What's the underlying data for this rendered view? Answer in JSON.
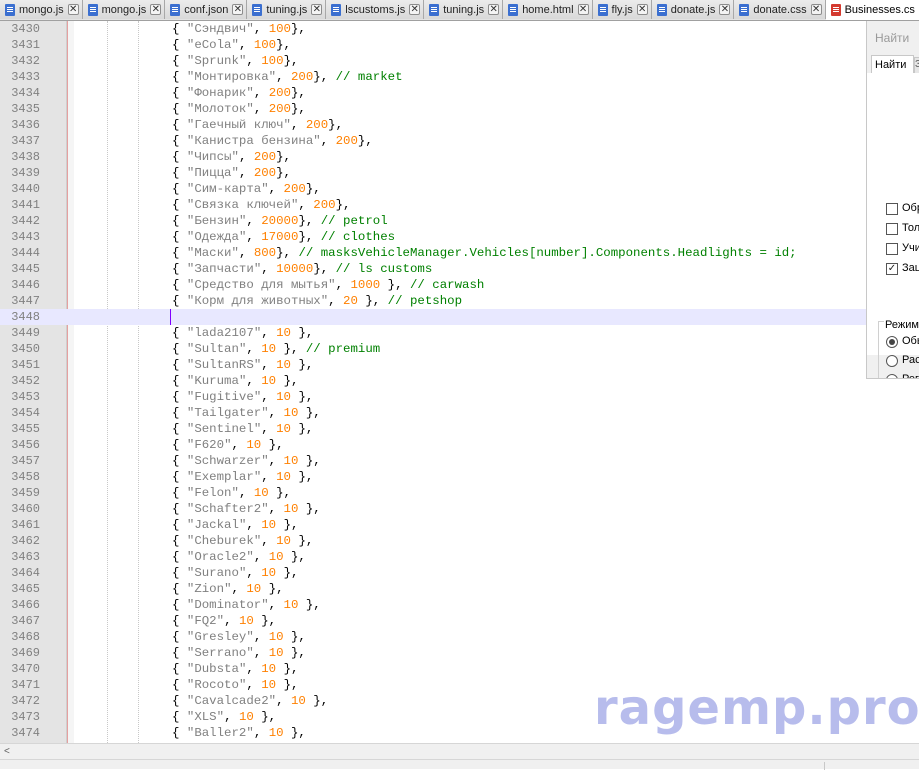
{
  "tabs": [
    {
      "label": "mongo.js",
      "active": false
    },
    {
      "label": "mongo.js",
      "active": false
    },
    {
      "label": "conf.json",
      "active": false
    },
    {
      "label": "tuning.js",
      "active": false
    },
    {
      "label": "lscustoms.js",
      "active": false
    },
    {
      "label": "tuning.js",
      "active": false
    },
    {
      "label": "home.html",
      "active": false
    },
    {
      "label": "fly.js",
      "active": false
    },
    {
      "label": "donate.js",
      "active": false
    },
    {
      "label": "donate.css",
      "active": false
    },
    {
      "label": "Businesses.cs",
      "active": true
    }
  ],
  "tab_close_glyph": "✕",
  "editor": {
    "current_line": 3448,
    "lines": [
      {
        "n": "3430",
        "name": "Сэндвич",
        "val": "100",
        "close": "},"
      },
      {
        "n": "3431",
        "name": "eCola",
        "val": "100",
        "close": "},"
      },
      {
        "n": "3432",
        "name": "Sprunk",
        "val": "100",
        "close": "},"
      },
      {
        "n": "3433",
        "name": "Монтировка",
        "val": "200",
        "close": "},",
        "comment": "// market"
      },
      {
        "n": "3434",
        "name": "Фонарик",
        "val": "200",
        "close": "},"
      },
      {
        "n": "3435",
        "name": "Молоток",
        "val": "200",
        "close": "},"
      },
      {
        "n": "3436",
        "name": "Гаечный ключ",
        "val": "200",
        "close": "},"
      },
      {
        "n": "3437",
        "name": "Канистра бензина",
        "val": "200",
        "close": "},"
      },
      {
        "n": "3438",
        "name": "Чипсы",
        "val": "200",
        "close": "},"
      },
      {
        "n": "3439",
        "name": "Пицца",
        "val": "200",
        "close": "},"
      },
      {
        "n": "3440",
        "name": "Сим-карта",
        "val": "200",
        "close": "},"
      },
      {
        "n": "3441",
        "name": "Связка ключей",
        "val": "200",
        "close": "},"
      },
      {
        "n": "3442",
        "name": "Бензин",
        "val": "20000",
        "close": "},",
        "comment": "// petrol"
      },
      {
        "n": "3443",
        "name": "Одежда",
        "val": "17000",
        "close": "},",
        "comment": "// clothes"
      },
      {
        "n": "3444",
        "name": "Маски",
        "val": "800",
        "close": "},",
        "comment": "// masksVehicleManager.Vehicles[number].Components.Headlights = id;"
      },
      {
        "n": "3445",
        "name": "Запчасти",
        "val": "10000",
        "close": "},",
        "comment": "// ls customs"
      },
      {
        "n": "3446",
        "name": "Средство для мытья",
        "val": "1000 ",
        "close": "},",
        "comment": "// carwash"
      },
      {
        "n": "3447",
        "name": "Корм для животных",
        "val": "20 ",
        "close": "},",
        "comment": "// petshop"
      },
      {
        "n": "3448",
        "empty": true
      },
      {
        "n": "3449",
        "name": "lada2107",
        "val": "10 ",
        "close": "},"
      },
      {
        "n": "3450",
        "name": "Sultan",
        "val": "10 ",
        "close": "},",
        "comment": "// premium"
      },
      {
        "n": "3451",
        "name": "SultanRS",
        "val": "10 ",
        "close": "},"
      },
      {
        "n": "3452",
        "name": "Kuruma",
        "val": "10 ",
        "close": "},"
      },
      {
        "n": "3453",
        "name": "Fugitive",
        "val": "10 ",
        "close": "},"
      },
      {
        "n": "3454",
        "name": "Tailgater",
        "val": "10 ",
        "close": "},"
      },
      {
        "n": "3455",
        "name": "Sentinel",
        "val": "10 ",
        "close": "},"
      },
      {
        "n": "3456",
        "name": "F620",
        "val": "10 ",
        "close": "},"
      },
      {
        "n": "3457",
        "name": "Schwarzer",
        "val": "10 ",
        "close": "},"
      },
      {
        "n": "3458",
        "name": "Exemplar",
        "val": "10 ",
        "close": "},"
      },
      {
        "n": "3459",
        "name": "Felon",
        "val": "10 ",
        "close": "},"
      },
      {
        "n": "3460",
        "name": "Schafter2",
        "val": "10 ",
        "close": "},"
      },
      {
        "n": "3461",
        "name": "Jackal",
        "val": "10 ",
        "close": "},"
      },
      {
        "n": "3462",
        "name": "Cheburek",
        "val": "10 ",
        "close": "},"
      },
      {
        "n": "3463",
        "name": "Oracle2",
        "val": "10 ",
        "close": "},"
      },
      {
        "n": "3464",
        "name": "Surano",
        "val": "10 ",
        "close": "},"
      },
      {
        "n": "3465",
        "name": "Zion",
        "val": "10 ",
        "close": "},"
      },
      {
        "n": "3466",
        "name": "Dominator",
        "val": "10 ",
        "close": "},"
      },
      {
        "n": "3467",
        "name": "FQ2",
        "val": "10 ",
        "close": "},"
      },
      {
        "n": "3468",
        "name": "Gresley",
        "val": "10 ",
        "close": "},"
      },
      {
        "n": "3469",
        "name": "Serrano",
        "val": "10 ",
        "close": "},"
      },
      {
        "n": "3470",
        "name": "Dubsta",
        "val": "10 ",
        "close": "},"
      },
      {
        "n": "3471",
        "name": "Rocoto",
        "val": "10 ",
        "close": "},"
      },
      {
        "n": "3472",
        "name": "Cavalcade2",
        "val": "10 ",
        "close": "},"
      },
      {
        "n": "3473",
        "name": "XLS",
        "val": "10 ",
        "close": "},"
      },
      {
        "n": "3474",
        "name": "Baller2",
        "val": "10 ",
        "close": "},"
      }
    ]
  },
  "find_panel": {
    "title": "Найти",
    "tab_label": "Найти",
    "tab2_label": "З",
    "checkboxes": [
      {
        "label": "Обр",
        "checked": false
      },
      {
        "label": "Тол",
        "checked": false
      },
      {
        "label": "Учи",
        "checked": false
      },
      {
        "label": "Зац",
        "checked": true
      }
    ],
    "mode_group_label": "Режим",
    "modes": [
      {
        "label": "Обы",
        "selected": true
      },
      {
        "label": "Рас",
        "selected": false
      },
      {
        "label": "Рег",
        "selected": false
      }
    ]
  },
  "scrollbar": {
    "left_arrow": "<"
  },
  "watermark": "ragemp.pro",
  "colors": {
    "string": "#808080",
    "number": "#ff8000",
    "comment": "#008000",
    "current_line": "#e8e8ff",
    "caret": "#8000ff",
    "active_tab_icon": "#d43a2f",
    "tab_icon": "#3b6fd0",
    "watermark": "#9fa6e6"
  },
  "icons": {
    "tab_icon": "file-icon",
    "close_icon": "close-icon",
    "checkbox_checked": "checkmark-icon"
  }
}
